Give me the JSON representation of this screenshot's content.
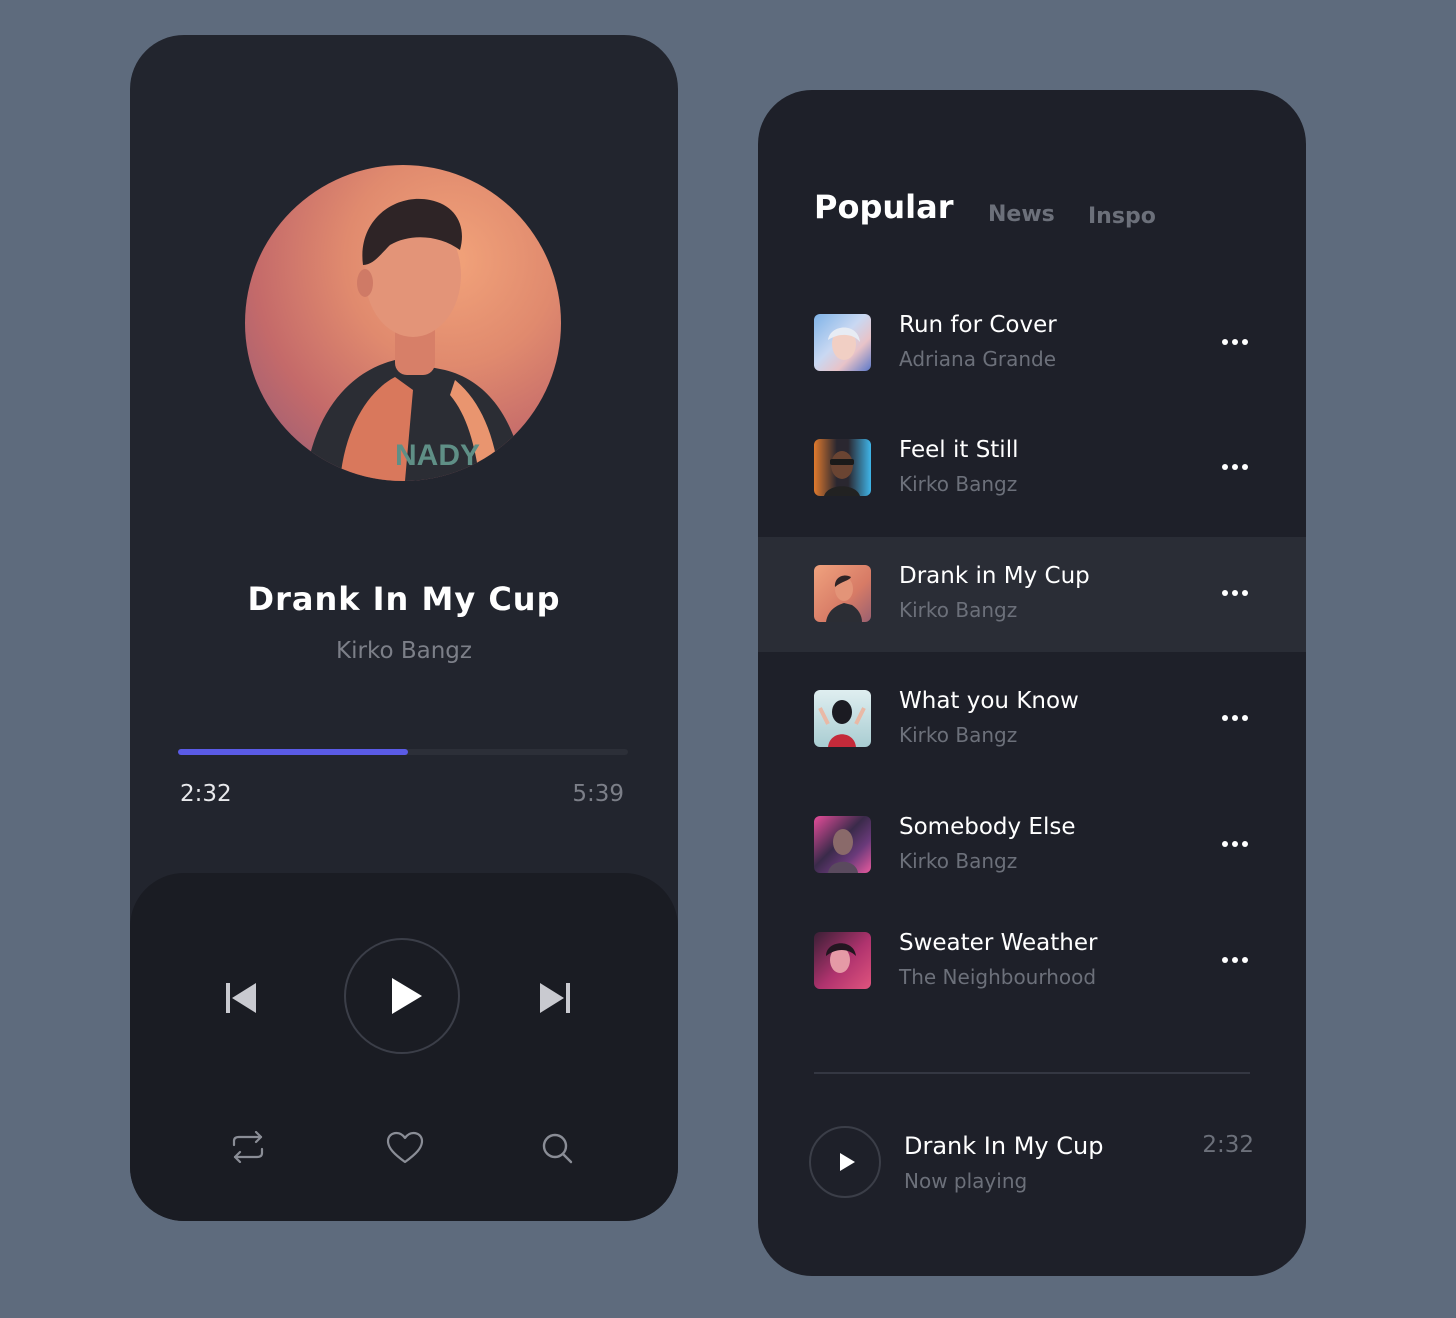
{
  "player": {
    "title": "Drank In My Cup",
    "artist": "Kirko Bangz",
    "progress": 0.51,
    "time_elapsed": "2:32",
    "time_total": "5:39",
    "accent_color": "#5a5be6"
  },
  "icons": {
    "previous": "skip-back-icon",
    "play": "play-icon",
    "next": "skip-forward-icon",
    "repeat": "repeat-icon",
    "like": "heart-icon",
    "search": "search-icon",
    "more": "more-dots-icon"
  },
  "playlist": {
    "tabs": [
      {
        "label": "Popular",
        "active": true
      },
      {
        "label": "News",
        "active": false
      },
      {
        "label": "Inspo",
        "active": false
      }
    ],
    "tracks": [
      {
        "title": "Run for Cover",
        "artist": "Adriana Grande",
        "selected": false
      },
      {
        "title": "Feel it Still",
        "artist": "Kirko Bangz",
        "selected": false
      },
      {
        "title": "Drank in My Cup",
        "artist": "Kirko Bangz",
        "selected": true
      },
      {
        "title": "What you Know",
        "artist": "Kirko Bangz",
        "selected": false
      },
      {
        "title": "Somebody Else",
        "artist": "Kirko Bangz",
        "selected": false
      },
      {
        "title": "Sweater Weather",
        "artist": "The Neighbourhood",
        "selected": false
      }
    ],
    "now_playing": {
      "title": "Drank In My Cup",
      "subtitle": "Now playing",
      "time": "2:32"
    }
  }
}
